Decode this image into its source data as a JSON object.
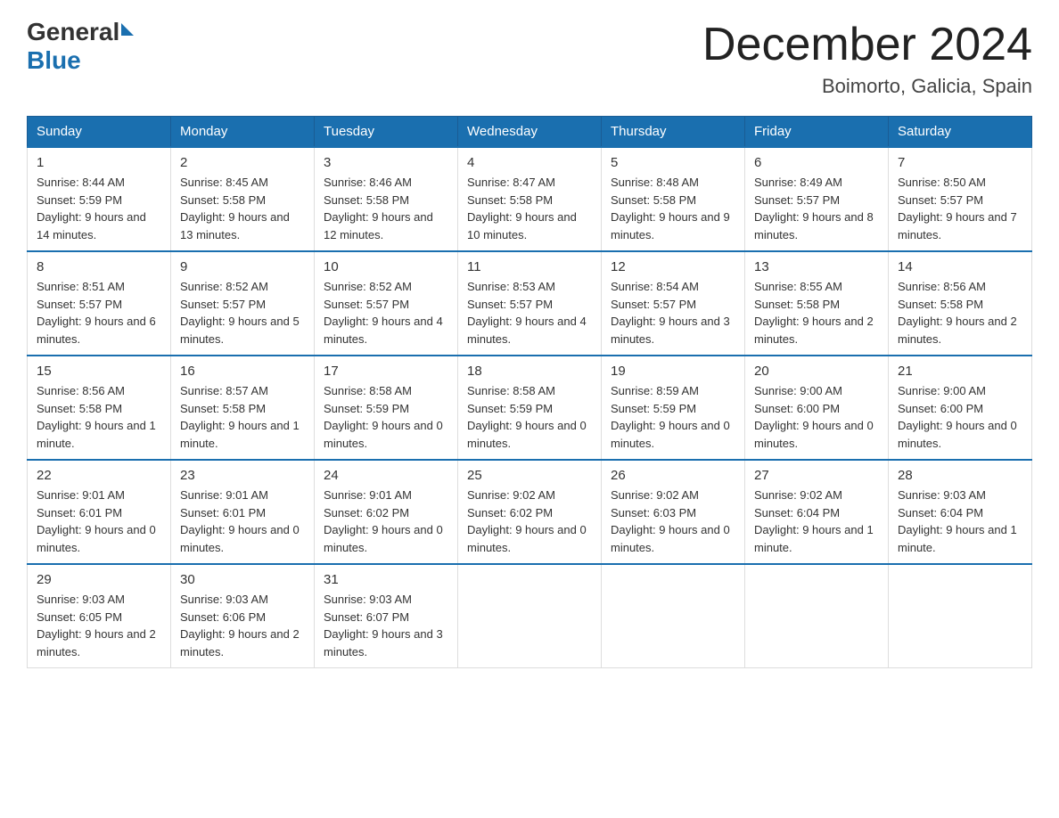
{
  "header": {
    "logo_general": "General",
    "logo_blue": "Blue",
    "month_title": "December 2024",
    "location": "Boimorto, Galicia, Spain"
  },
  "weekdays": [
    "Sunday",
    "Monday",
    "Tuesday",
    "Wednesday",
    "Thursday",
    "Friday",
    "Saturday"
  ],
  "weeks": [
    [
      {
        "day": "1",
        "sunrise": "8:44 AM",
        "sunset": "5:59 PM",
        "daylight": "9 hours and 14 minutes."
      },
      {
        "day": "2",
        "sunrise": "8:45 AM",
        "sunset": "5:58 PM",
        "daylight": "9 hours and 13 minutes."
      },
      {
        "day": "3",
        "sunrise": "8:46 AM",
        "sunset": "5:58 PM",
        "daylight": "9 hours and 12 minutes."
      },
      {
        "day": "4",
        "sunrise": "8:47 AM",
        "sunset": "5:58 PM",
        "daylight": "9 hours and 10 minutes."
      },
      {
        "day": "5",
        "sunrise": "8:48 AM",
        "sunset": "5:58 PM",
        "daylight": "9 hours and 9 minutes."
      },
      {
        "day": "6",
        "sunrise": "8:49 AM",
        "sunset": "5:57 PM",
        "daylight": "9 hours and 8 minutes."
      },
      {
        "day": "7",
        "sunrise": "8:50 AM",
        "sunset": "5:57 PM",
        "daylight": "9 hours and 7 minutes."
      }
    ],
    [
      {
        "day": "8",
        "sunrise": "8:51 AM",
        "sunset": "5:57 PM",
        "daylight": "9 hours and 6 minutes."
      },
      {
        "day": "9",
        "sunrise": "8:52 AM",
        "sunset": "5:57 PM",
        "daylight": "9 hours and 5 minutes."
      },
      {
        "day": "10",
        "sunrise": "8:52 AM",
        "sunset": "5:57 PM",
        "daylight": "9 hours and 4 minutes."
      },
      {
        "day": "11",
        "sunrise": "8:53 AM",
        "sunset": "5:57 PM",
        "daylight": "9 hours and 4 minutes."
      },
      {
        "day": "12",
        "sunrise": "8:54 AM",
        "sunset": "5:57 PM",
        "daylight": "9 hours and 3 minutes."
      },
      {
        "day": "13",
        "sunrise": "8:55 AM",
        "sunset": "5:58 PM",
        "daylight": "9 hours and 2 minutes."
      },
      {
        "day": "14",
        "sunrise": "8:56 AM",
        "sunset": "5:58 PM",
        "daylight": "9 hours and 2 minutes."
      }
    ],
    [
      {
        "day": "15",
        "sunrise": "8:56 AM",
        "sunset": "5:58 PM",
        "daylight": "9 hours and 1 minute."
      },
      {
        "day": "16",
        "sunrise": "8:57 AM",
        "sunset": "5:58 PM",
        "daylight": "9 hours and 1 minute."
      },
      {
        "day": "17",
        "sunrise": "8:58 AM",
        "sunset": "5:59 PM",
        "daylight": "9 hours and 0 minutes."
      },
      {
        "day": "18",
        "sunrise": "8:58 AM",
        "sunset": "5:59 PM",
        "daylight": "9 hours and 0 minutes."
      },
      {
        "day": "19",
        "sunrise": "8:59 AM",
        "sunset": "5:59 PM",
        "daylight": "9 hours and 0 minutes."
      },
      {
        "day": "20",
        "sunrise": "9:00 AM",
        "sunset": "6:00 PM",
        "daylight": "9 hours and 0 minutes."
      },
      {
        "day": "21",
        "sunrise": "9:00 AM",
        "sunset": "6:00 PM",
        "daylight": "9 hours and 0 minutes."
      }
    ],
    [
      {
        "day": "22",
        "sunrise": "9:01 AM",
        "sunset": "6:01 PM",
        "daylight": "9 hours and 0 minutes."
      },
      {
        "day": "23",
        "sunrise": "9:01 AM",
        "sunset": "6:01 PM",
        "daylight": "9 hours and 0 minutes."
      },
      {
        "day": "24",
        "sunrise": "9:01 AM",
        "sunset": "6:02 PM",
        "daylight": "9 hours and 0 minutes."
      },
      {
        "day": "25",
        "sunrise": "9:02 AM",
        "sunset": "6:02 PM",
        "daylight": "9 hours and 0 minutes."
      },
      {
        "day": "26",
        "sunrise": "9:02 AM",
        "sunset": "6:03 PM",
        "daylight": "9 hours and 0 minutes."
      },
      {
        "day": "27",
        "sunrise": "9:02 AM",
        "sunset": "6:04 PM",
        "daylight": "9 hours and 1 minute."
      },
      {
        "day": "28",
        "sunrise": "9:03 AM",
        "sunset": "6:04 PM",
        "daylight": "9 hours and 1 minute."
      }
    ],
    [
      {
        "day": "29",
        "sunrise": "9:03 AM",
        "sunset": "6:05 PM",
        "daylight": "9 hours and 2 minutes."
      },
      {
        "day": "30",
        "sunrise": "9:03 AM",
        "sunset": "6:06 PM",
        "daylight": "9 hours and 2 minutes."
      },
      {
        "day": "31",
        "sunrise": "9:03 AM",
        "sunset": "6:07 PM",
        "daylight": "9 hours and 3 minutes."
      },
      null,
      null,
      null,
      null
    ]
  ]
}
